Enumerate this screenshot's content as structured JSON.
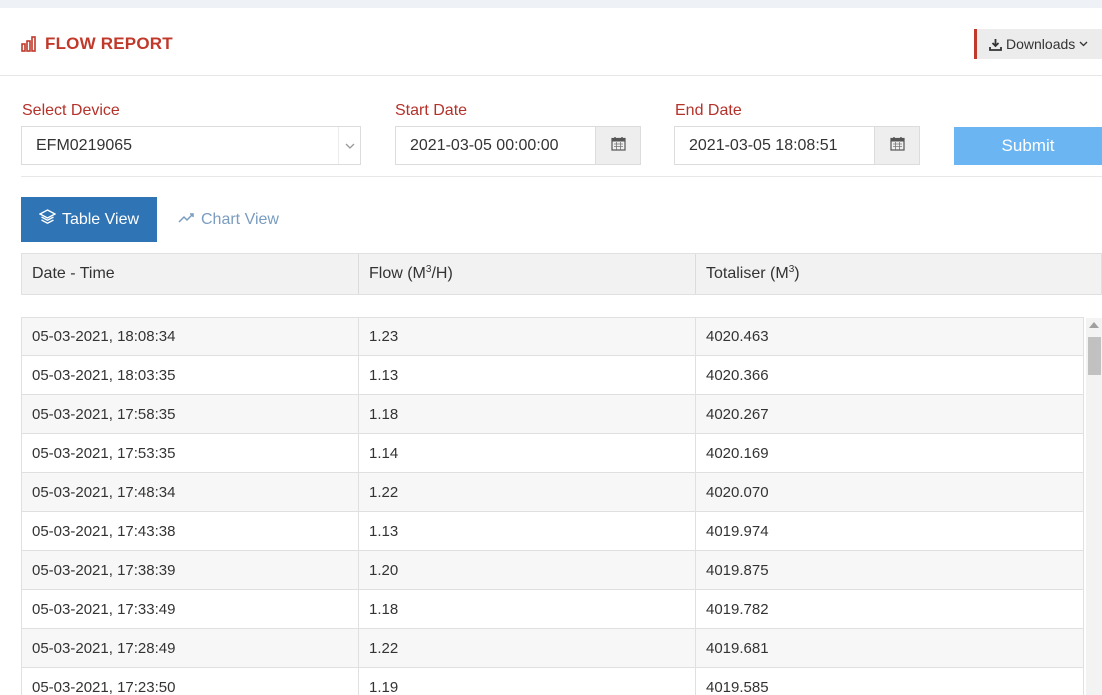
{
  "header": {
    "title": "FLOW REPORT",
    "downloads_label": "Downloads"
  },
  "filters": {
    "device_label": "Select Device",
    "device_value": "EFM0219065",
    "start_label": "Start Date",
    "start_value": "2021-03-05 00:00:00",
    "end_label": "End Date",
    "end_value": "2021-03-05 18:08:51",
    "submit_label": "Submit"
  },
  "tabs": {
    "table_view": "Table View",
    "chart_view": "Chart View"
  },
  "table": {
    "headers": {
      "datetime": "Date - Time",
      "flow_prefix": "Flow (M",
      "flow_sup": "3",
      "flow_suffix": "/H)",
      "totaliser_prefix": "Totaliser (M",
      "totaliser_sup": "3",
      "totaliser_suffix": ")"
    },
    "rows": [
      {
        "datetime": "05-03-2021, 18:08:34",
        "flow": "1.23",
        "totaliser": "4020.463"
      },
      {
        "datetime": "05-03-2021, 18:03:35",
        "flow": "1.13",
        "totaliser": "4020.366"
      },
      {
        "datetime": "05-03-2021, 17:58:35",
        "flow": "1.18",
        "totaliser": "4020.267"
      },
      {
        "datetime": "05-03-2021, 17:53:35",
        "flow": "1.14",
        "totaliser": "4020.169"
      },
      {
        "datetime": "05-03-2021, 17:48:34",
        "flow": "1.22",
        "totaliser": "4020.070"
      },
      {
        "datetime": "05-03-2021, 17:43:38",
        "flow": "1.13",
        "totaliser": "4019.974"
      },
      {
        "datetime": "05-03-2021, 17:38:39",
        "flow": "1.20",
        "totaliser": "4019.875"
      },
      {
        "datetime": "05-03-2021, 17:33:49",
        "flow": "1.18",
        "totaliser": "4019.782"
      },
      {
        "datetime": "05-03-2021, 17:28:49",
        "flow": "1.22",
        "totaliser": "4019.681"
      },
      {
        "datetime": "05-03-2021, 17:23:50",
        "flow": "1.19",
        "totaliser": "4019.585"
      }
    ]
  },
  "colors": {
    "accent_red": "#c0392b",
    "primary_blue": "#2f74b5",
    "submit_blue": "#6bb6f2"
  }
}
